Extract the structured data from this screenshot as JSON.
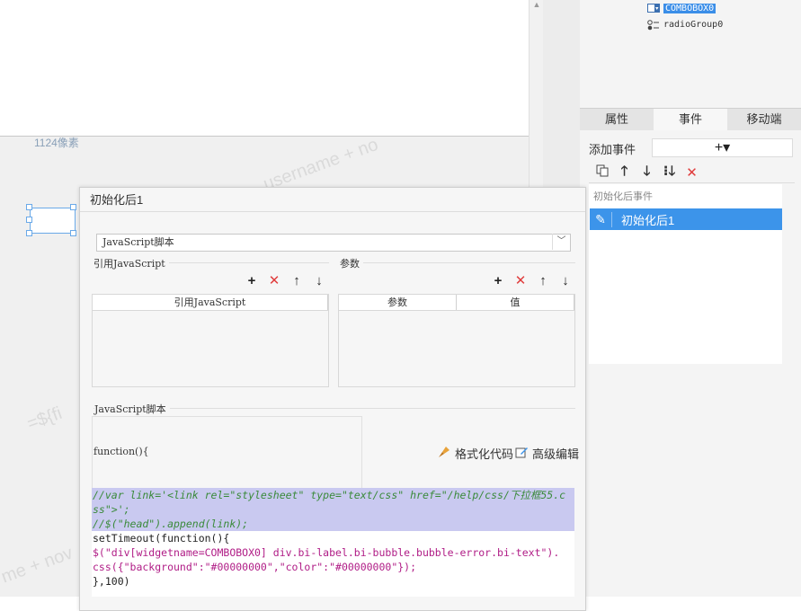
{
  "canvas": {
    "ruler_label": "1124像素",
    "watermarks": [
      "username + no",
      "=${fi",
      "me + nov"
    ]
  },
  "widget_tree": {
    "items": [
      {
        "label": "COMBOBOX0",
        "icon": "combobox-icon",
        "selected": true
      },
      {
        "label": "radioGroup0",
        "icon": "radio-group-icon",
        "selected": false
      }
    ]
  },
  "right_panel": {
    "tabs": [
      {
        "label": "属性",
        "active": false
      },
      {
        "label": "事件",
        "active": true
      },
      {
        "label": "移动端",
        "active": false
      }
    ],
    "add_event_label": "添加事件",
    "add_event_button": "+▾",
    "toolbar": [
      "copy-icon",
      "arrow-up-icon",
      "arrow-down-icon",
      "move-bottom-icon",
      "delete-icon"
    ],
    "event_group": "初始化后事件",
    "event_item": "初始化后1"
  },
  "dialog": {
    "title": "初始化后1",
    "script_type": "JavaScript脚本",
    "ref_section_label": "引用JavaScript",
    "param_section_label": "参数",
    "ref_table_header": "引用JavaScript",
    "param_table_headers": [
      "参数",
      "值"
    ],
    "js_section_label": "JavaScript脚本",
    "function_header": "function(){",
    "format_button": "格式化代码",
    "advanced_button": "高级编辑",
    "code_lines": [
      "//var link='<link rel=\"stylesheet\" type=\"text/css\" href=\"/help/css/下拉框55.c",
      "ss\">';",
      "//$(\"head\").append(link);",
      "setTimeout(function(){",
      "$(\"div[widgetname=COMBOBOX0] div.bi-label.bi-bubble.bubble-error.bi-text\").",
      "css({\"background\":\"#00000000\",\"color\":\"#00000000\"});",
      "},100)"
    ]
  },
  "colors": {
    "accent": "#3c94ea",
    "delete": "#e03c3c",
    "comment": "#3a8a3a",
    "keyword": "#7a2ab8",
    "string": "#b01c86"
  }
}
